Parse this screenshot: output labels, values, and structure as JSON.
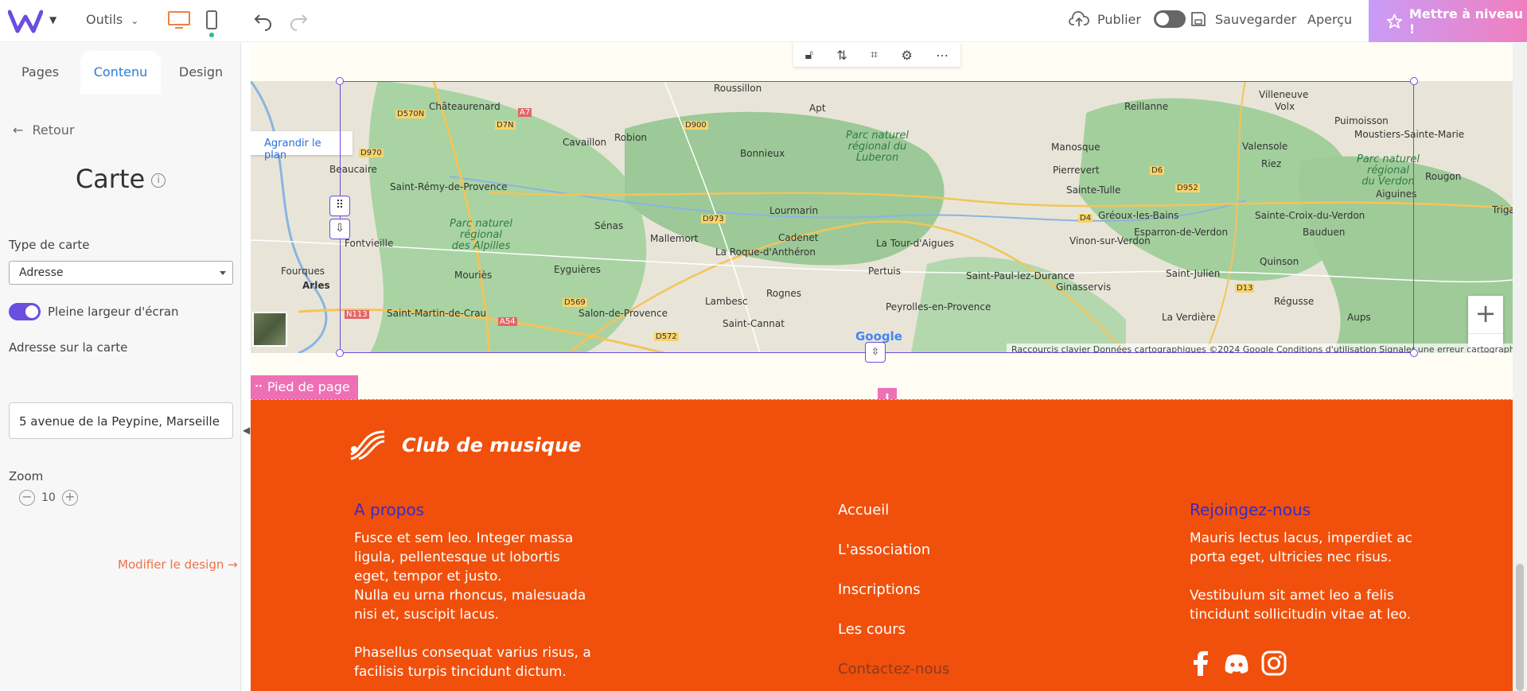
{
  "topbar": {
    "tools_label": "Outils",
    "publish_label": "Publier",
    "save_label": "Sauvegarder",
    "preview_label": "Aperçu",
    "upgrade_label": "Mettre à niveau !"
  },
  "sidebar": {
    "tabs": [
      {
        "label": "Pages"
      },
      {
        "label": "Contenu"
      },
      {
        "label": "Design"
      }
    ],
    "back_label": "Retour",
    "heading": "Carte",
    "map_type_label": "Type de carte",
    "map_type_value": "Adresse",
    "fullwidth_label": "Pleine largeur d'écran",
    "address_label": "Adresse sur la carte",
    "address_value": "5 avenue de la Peypine, Marseille",
    "zoom_label": "Zoom",
    "zoom_value": "10",
    "modify_design_label": "Modifier le design →"
  },
  "map": {
    "enlarge_label": "Agrandir le plan",
    "attribution": "Raccourcis clavier   Données cartographiques ©2024 Google   Conditions d'utilisation   Signaler une erreur cartographique",
    "google_logo": "Google",
    "places": [
      "Roussillon",
      "Villeneuve",
      "Châteaurenard",
      "Reillanne",
      "Volx",
      "Puimoisson",
      "Moustiers-Sainte-Marie",
      "Cavaillon",
      "Robion",
      "Bonnieux",
      "Apt",
      "Manosque",
      "Valensole",
      "Riez",
      "Beaucaire",
      "Saint-Rémy-de-Provence",
      "Pierrevert",
      "Sainte-Tulle",
      "Rougon",
      "Aiguines",
      "Lourmarin",
      "Sénas",
      "Mallemort",
      "Cadenet",
      "La Tour-d'Aigues",
      "Gréoux-les-Bains",
      "Esparron-de-Verdon",
      "Sainte-Croix-du-Verdon",
      "Bauduen",
      "Trigan",
      "Fontvieille",
      "La Roque-d'Anthéron",
      "Vinon-sur-Verdon",
      "Fourques",
      "Arles",
      "Mouriès",
      "Eyguières",
      "Pertuis",
      "Saint-Paul-lez-Durance",
      "Saint-Julien",
      "Quinson",
      "Ginasservis",
      "Saint-Martin-de-Crau",
      "Salon-de-Provence",
      "Lambesc",
      "Rognes",
      "Peyrolles-en-Provence",
      "Régusse",
      "Saint-Cannat",
      "La Verdière",
      "Aups"
    ],
    "parks": [
      "Parc naturel\nrégional du\nLuberon",
      "Parc naturel\nrégional\ndes Alpilles",
      "Parc naturel\nrégional\ndu Verdon"
    ],
    "roads": [
      "D570N",
      "A7",
      "D7N",
      "D900",
      "D970",
      "D973",
      "D6",
      "D952",
      "D4",
      "D13",
      "D569",
      "D572",
      "N113",
      "A54"
    ]
  },
  "footer": {
    "tag_label": "Pied de page",
    "brand": "Club de musique",
    "about_title": "A propos",
    "about_text": "Fusce et sem leo. Integer massa\nligula, pellentesque ut lobortis\neget, tempor et justo.\nNulla eu urna rhoncus, malesuada\nnisi et, suscipit lacus.\n\nPhasellus consequat varius risus, a\nfacilisis turpis tincidunt dictum.",
    "nav": [
      "Accueil",
      "L'association",
      "Inscriptions",
      "Les cours",
      "Contactez-nous"
    ],
    "join_title": "Rejoingez-nous",
    "join_text": "Mauris lectus lacus, imperdiet ac\nporta eget, ultricies nec risus.\n\nVestibulum sit amet leo a felis\ntincidunt sollicitudin vitae at leo."
  },
  "colors": {
    "accent": "#2a7bd8",
    "selection": "#6a4ee0",
    "footer_bg": "#f0500c",
    "upgrade_gradient_start": "#c99cf7",
    "upgrade_gradient_end": "#f07fbf"
  },
  "icons": [
    "logo-icon",
    "desktop-icon",
    "mobile-icon",
    "undo-icon",
    "redo-icon",
    "upload-cloud-icon",
    "save-icon",
    "star-icon",
    "facebook-icon",
    "discord-icon",
    "instagram-icon"
  ]
}
